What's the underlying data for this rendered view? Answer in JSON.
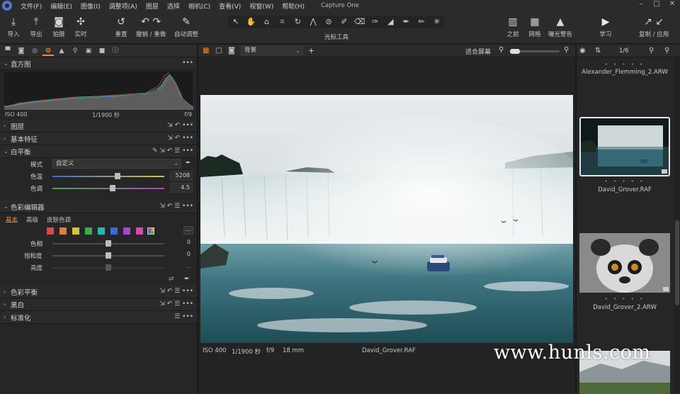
{
  "app": {
    "title": "Capture One"
  },
  "menu": [
    "文件(F)",
    "编辑(E)",
    "图像(I)",
    "调整项(A)",
    "图层",
    "选择",
    "相机(C)",
    "查看(V)",
    "视窗(W)",
    "帮助(H)"
  ],
  "toolbar": {
    "import": "导入",
    "export": "导出",
    "capture": "拍摄",
    "live": "实时",
    "reset": "重置",
    "undo_redo": "撤销 / 重做",
    "auto_adjust": "自动调整",
    "cursor_tools": "光标工具",
    "before": "之前",
    "grid": "网格",
    "exposure_warning": "曝光警告",
    "learn": "学习",
    "copy_apply": "复制 / 应用"
  },
  "histogram": {
    "title": "直方图",
    "iso": "ISO 400",
    "shutter": "1/1900 秒",
    "aperture": "f/9"
  },
  "sections": {
    "layers": "图层",
    "base_characteristics": "基本特征",
    "white_balance": "白平衡",
    "color_editor": "色彩编辑器",
    "color_balance": "色彩平衡",
    "black_white": "黑白",
    "normalize": "标准化"
  },
  "white_balance": {
    "mode_label": "模式",
    "mode_value": "自定义",
    "kelvin_label": "色温",
    "kelvin_value": "5208",
    "tint_label": "色调",
    "tint_value": "4.5"
  },
  "color_editor": {
    "tabs": [
      "基本",
      "高级",
      "皮肤色调"
    ],
    "hue_label": "色相",
    "hue_value": "0",
    "saturation_label": "饱和度",
    "saturation_value": "0",
    "lightness_label": "亮度",
    "more_button": "...",
    "swatches": [
      "#d94a4a",
      "#e2803a",
      "#d8c43a",
      "#3aae4a",
      "#2cb6b0",
      "#3a6ad8",
      "#a04ad0",
      "#d84aa8"
    ]
  },
  "viewer": {
    "background_label": "背景",
    "fit_label": "适合屏幕",
    "status_iso": "ISO 400",
    "status_shutter": "1/1900 秒",
    "status_aperture": "f/9",
    "status_focal": "18 mm",
    "status_filename": "David_Grover.RAF"
  },
  "browser": {
    "counter": "1/6",
    "items": [
      {
        "name": "Alexander_Flemming_2.ARW"
      },
      {
        "name": "David_Grover.RAF"
      },
      {
        "name": "David_Grover_2.ARW"
      }
    ],
    "rating_dots": "• • • • •"
  },
  "watermark": "www.hunls.com",
  "colors": {
    "accent": "#f08a2c",
    "panel": "#262626",
    "toolbar": "#2b2b2b"
  }
}
